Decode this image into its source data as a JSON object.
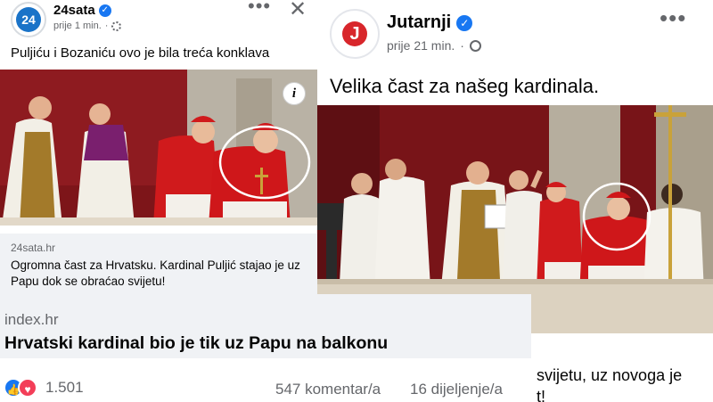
{
  "left_post": {
    "page_name": "24sata",
    "avatar_text": "24",
    "timestamp": "prije 1 min.",
    "more_label": "•••",
    "close_label": "✕",
    "post_text": "Puljiću i Bozaniću ovo je bila treća konklava",
    "info_label": "i",
    "link": {
      "domain": "24sata.hr",
      "title": "Ogromna čast za Hrvatsku. Kardinal Puljić stajao je uz Papu dok se obraćao svijetu!"
    }
  },
  "right_post": {
    "page_name": "Jutarnji",
    "avatar_text": "J",
    "timestamp": "prije 21 min.",
    "separator": "·",
    "more_label": "•••",
    "post_text": "Velika čast za našeg kardinala.",
    "bottom_text_line1": "svijetu, uz novoga je",
    "bottom_text_line2": "t!"
  },
  "bottom_card": {
    "domain": "index.hr",
    "title": "Hrvatski kardinal bio je tik uz Papu na balkonu",
    "reaction_count": "1.501",
    "comments": "547 komentar/a",
    "shares": "16 dijeljenje/a"
  },
  "icons": {
    "verified": "verified-badge-icon",
    "settings": "gear-icon",
    "globe": "globe-icon",
    "like": "like-icon",
    "love": "love-icon"
  },
  "colors": {
    "facebook_blue": "#1877f2",
    "love_red": "#f33e58",
    "secondary_text": "#65676b",
    "link_box_bg": "#f0f2f5",
    "cardinal_red": "#c8141b",
    "jutarnji_red": "#d8262b"
  }
}
